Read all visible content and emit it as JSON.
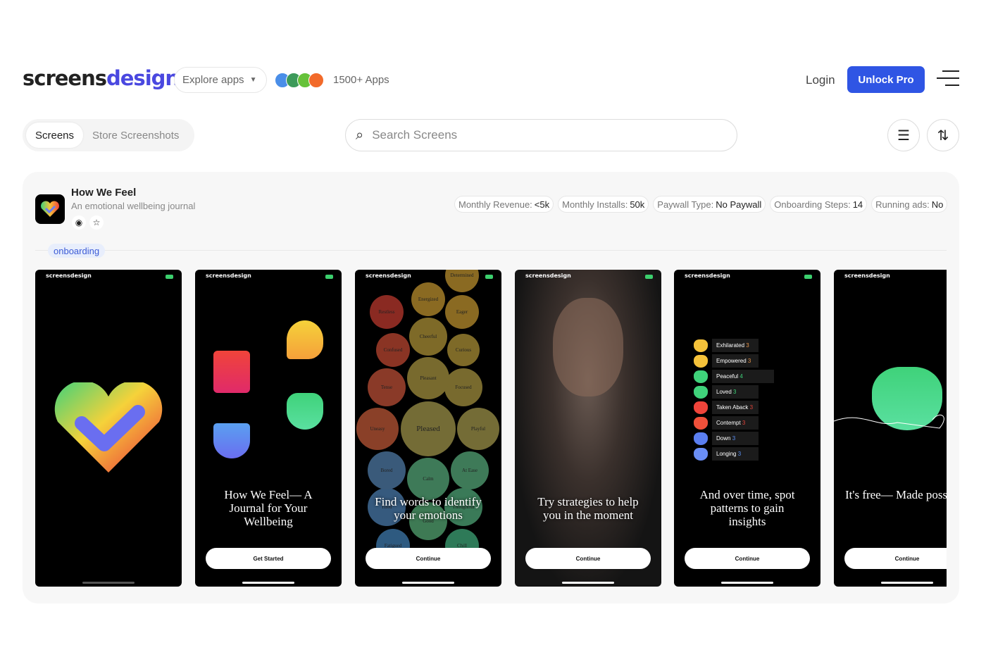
{
  "header": {
    "logo_a": "screens",
    "logo_b": "design",
    "explore": "Explore apps",
    "app_count": "1500+ Apps",
    "login": "Login",
    "unlock": "Unlock Pro",
    "app_avatar_colors": [
      "#4a8ee8",
      "#3d9a5a",
      "#66c23a",
      "#f26a2a"
    ]
  },
  "toolbar": {
    "tabs": [
      {
        "label": "Screens",
        "active": true
      },
      {
        "label": "Store Screenshots",
        "active": false
      }
    ],
    "search_placeholder": "Search Screens"
  },
  "app": {
    "name": "How We Feel",
    "subtitle": "An emotional wellbeing journal",
    "tag": "onboarding",
    "stats": [
      {
        "label": "Monthly Revenue:",
        "value": "<5k"
      },
      {
        "label": "Monthly Installs:",
        "value": "50k"
      },
      {
        "label": "Paywall Type:",
        "value": "No Paywall"
      },
      {
        "label": "Onboarding Steps:",
        "value": "14"
      },
      {
        "label": "Running ads:",
        "value": "No"
      }
    ]
  },
  "screens": {
    "watermark": "screensdesign",
    "s2": {
      "caption": "How We Feel— A Journal for Your Wellbeing",
      "button": "Get Started"
    },
    "s3": {
      "caption": "Find words to identify your emotions",
      "button": "Continue",
      "bubbles": [
        {
          "label": "Energized",
          "color": "#8a6a22"
        },
        {
          "label": "Eager",
          "color": "#8a6a22"
        },
        {
          "label": "Restless",
          "color": "#8a2a22"
        },
        {
          "label": "Cheerful",
          "color": "#7e6a28"
        },
        {
          "label": "Curious",
          "color": "#7e6a28"
        },
        {
          "label": "Confused",
          "color": "#8a3424"
        },
        {
          "label": "Pleasant",
          "color": "#786a2e"
        },
        {
          "label": "Focused",
          "color": "#786a2e"
        },
        {
          "label": "Tense",
          "color": "#8a3a28"
        },
        {
          "label": "Uneasy",
          "color": "#8a4028"
        },
        {
          "label": "Pleased",
          "color": "#746c36"
        },
        {
          "label": "Playful",
          "color": "#746c36"
        },
        {
          "label": "Bored",
          "color": "#3a5a7a"
        },
        {
          "label": "Calm",
          "color": "#3e7a58"
        },
        {
          "label": "At Ease",
          "color": "#3e7a58"
        },
        {
          "label": "Tired",
          "color": "#365a7e"
        },
        {
          "label": "Thoughtful",
          "color": "#3a7a58"
        },
        {
          "label": "Good",
          "color": "#3e7a54"
        },
        {
          "label": "Fatigued",
          "color": "#2e5a80"
        },
        {
          "label": "Chill",
          "color": "#2e7a58"
        },
        {
          "label": "Determined",
          "color": "#8a6a22"
        }
      ]
    },
    "s4": {
      "caption": "Try strategies to help you in the moment",
      "button": "Continue"
    },
    "s5": {
      "caption": "And over time, spot patterns to gain insights",
      "button": "Continue",
      "emotions": [
        {
          "label": "Exhilarated",
          "count": "3",
          "color": "#f5c23a",
          "count_color": "#e5934a"
        },
        {
          "label": "Empowered",
          "count": "3",
          "color": "#f5c23a",
          "count_color": "#e5934a"
        },
        {
          "label": "Peaceful",
          "count": "4",
          "color": "#3fd27a",
          "count_color": "#3fd27a"
        },
        {
          "label": "Loved",
          "count": "3",
          "color": "#3fd27a",
          "count_color": "#3fd27a"
        },
        {
          "label": "Taken Aback",
          "count": "3",
          "color": "#f0443a",
          "count_color": "#e0443a"
        },
        {
          "label": "Contempt",
          "count": "3",
          "color": "#f0503a",
          "count_color": "#e0443a"
        },
        {
          "label": "Down",
          "count": "3",
          "color": "#5a7ef0",
          "count_color": "#5a8ef0"
        },
        {
          "label": "Longing",
          "count": "3",
          "color": "#6a8ef5",
          "count_color": "#5a8ef0"
        }
      ]
    },
    "s6": {
      "caption": "It's free— Made possible by donations",
      "button": "Continue"
    }
  }
}
